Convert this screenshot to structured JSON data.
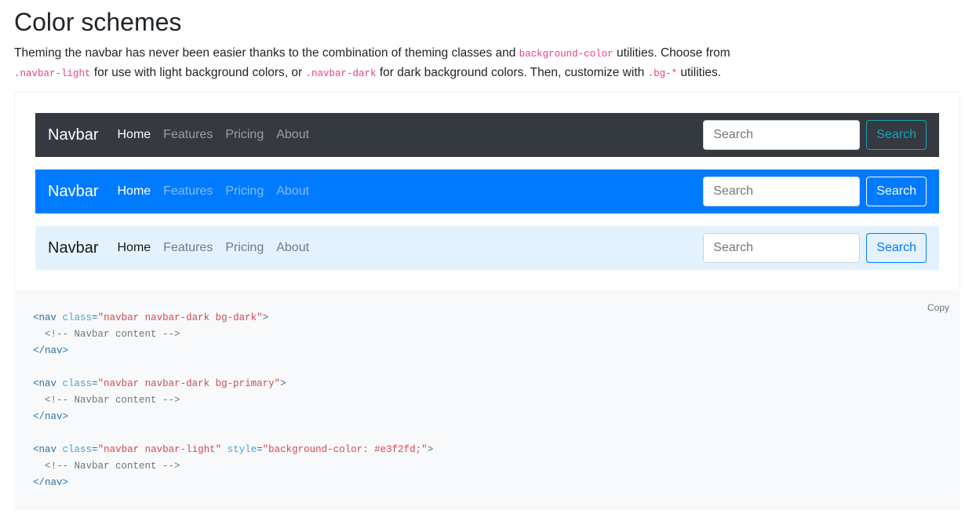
{
  "heading": "Color schemes",
  "description": {
    "t1": "Theming the navbar has never been easier thanks to the combination of theming classes and ",
    "c1": "background-color",
    "t2": " utilities. Choose from ",
    "c2": ".navbar-light",
    "t3": " for use with light background colors, or ",
    "c3": ".navbar-dark",
    "t4": " for dark background colors. Then, customize with ",
    "c4": ".bg-*",
    "t5": " utilities."
  },
  "navbars": [
    {
      "brand": "Navbar",
      "links": [
        "Home",
        "Features",
        "Pricing",
        "About"
      ],
      "search_placeholder": "Search",
      "search_button": "Search",
      "background": "#343a40"
    },
    {
      "brand": "Navbar",
      "links": [
        "Home",
        "Features",
        "Pricing",
        "About"
      ],
      "search_placeholder": "Search",
      "search_button": "Search",
      "background": "#007bff"
    },
    {
      "brand": "Navbar",
      "links": [
        "Home",
        "Features",
        "Pricing",
        "About"
      ],
      "search_placeholder": "Search",
      "search_button": "Search",
      "background": "#e3f2fd"
    }
  ],
  "code": {
    "copy_label": "Copy",
    "blocks": [
      {
        "class": "\"navbar navbar-dark bg-dark\"",
        "style": "",
        "comment": "<!-- Navbar content -->"
      },
      {
        "class": "\"navbar navbar-dark bg-primary\"",
        "style": "",
        "comment": "<!-- Navbar content -->"
      },
      {
        "class": "\"navbar navbar-light\"",
        "style": "\"background-color: #e3f2fd;\"",
        "comment": "<!-- Navbar content -->"
      }
    ]
  }
}
